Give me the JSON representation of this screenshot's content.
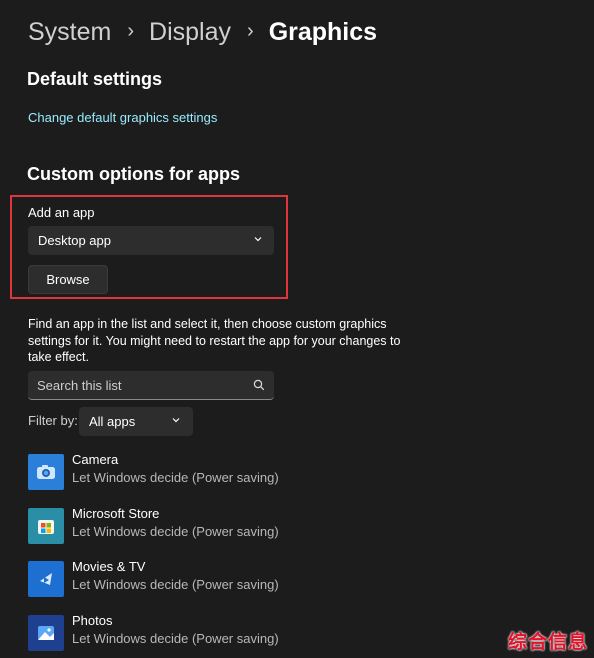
{
  "breadcrumb": {
    "items": [
      "System",
      "Display",
      "Graphics"
    ],
    "separator": "›"
  },
  "default_settings": {
    "title": "Default settings",
    "link": "Change default graphics settings"
  },
  "custom_options": {
    "title": "Custom options for apps",
    "add_app_label": "Add an app",
    "app_type_selected": "Desktop app",
    "browse_label": "Browse",
    "description": "Find an app in the list and select it, then choose custom graphics settings for it. You might need to restart the app for your changes to take effect.",
    "search_placeholder": "Search this list",
    "filter_label": "Filter by:",
    "filter_selected": "All apps"
  },
  "apps": [
    {
      "name": "Camera",
      "status": "Let Windows decide (Power saving)",
      "icon": "camera-icon"
    },
    {
      "name": "Microsoft Store",
      "status": "Let Windows decide (Power saving)",
      "icon": "store-icon"
    },
    {
      "name": "Movies & TV",
      "status": "Let Windows decide (Power saving)",
      "icon": "movies-icon"
    },
    {
      "name": "Photos",
      "status": "Let Windows decide (Power saving)",
      "icon": "photos-icon"
    }
  ],
  "watermark": "综合信息",
  "colors": {
    "background": "#1c1c1c",
    "control": "#2d2d2d",
    "link": "#99ebff",
    "highlight": "#e0363b"
  }
}
